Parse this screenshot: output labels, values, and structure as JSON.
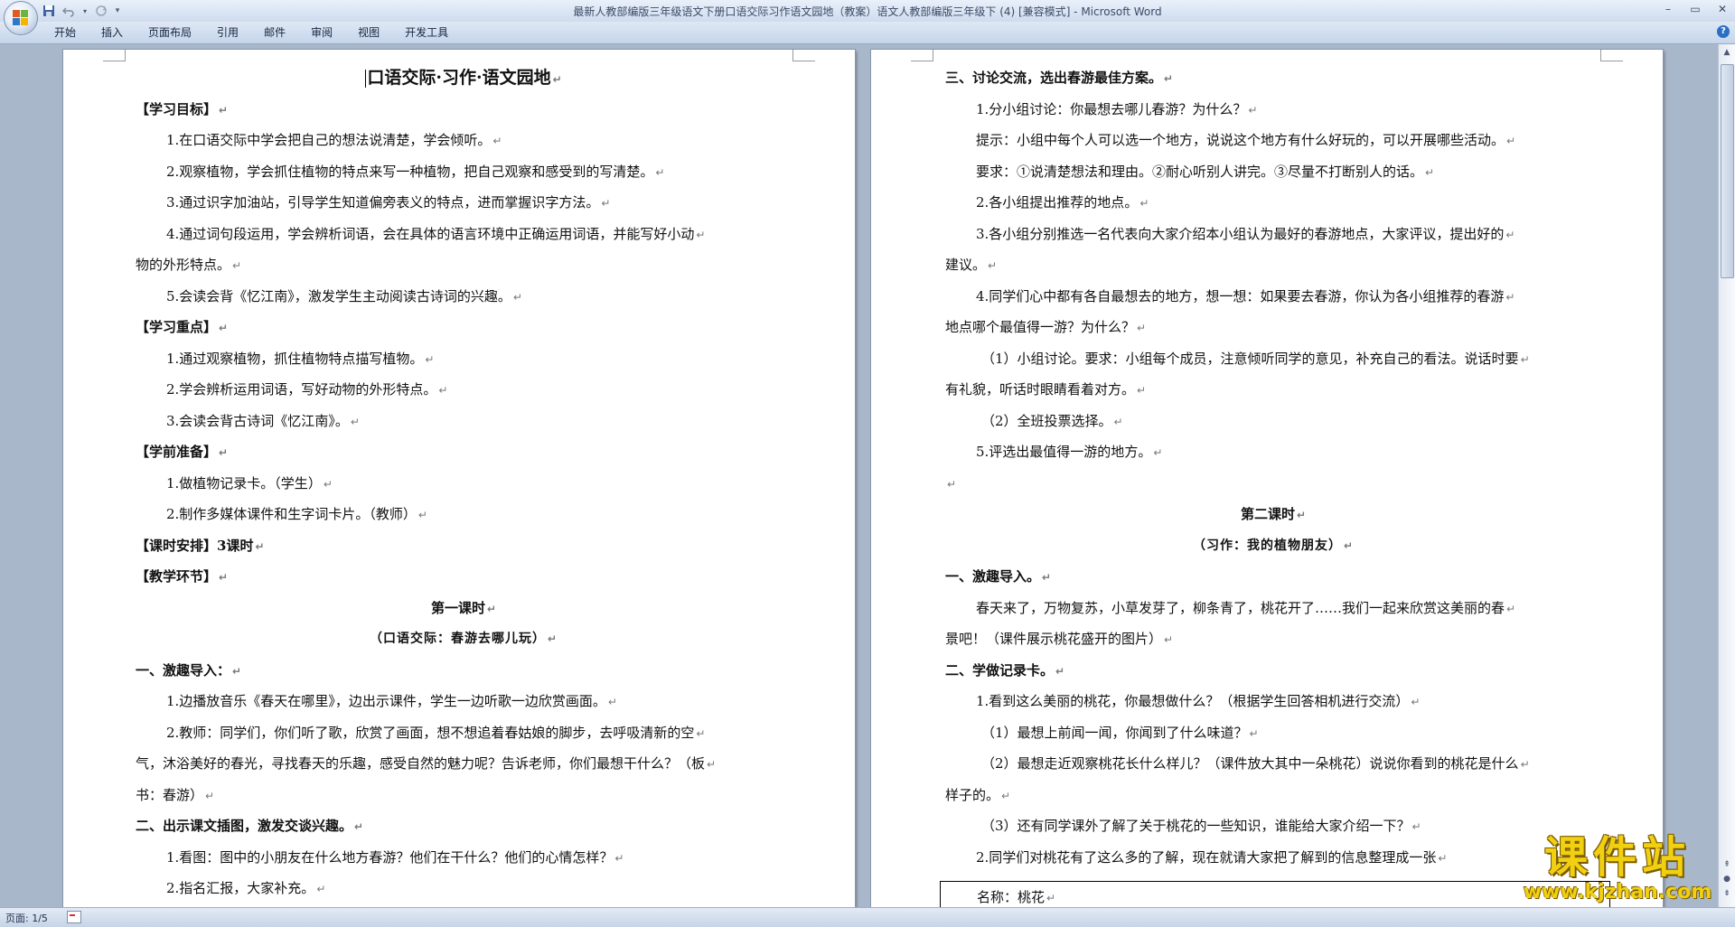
{
  "window": {
    "title": "最新人教部编版三年级语文下册口语交际习作语文园地（教案）语文人教部编版三年级下 (4) [兼容模式] - Microsoft Word",
    "controls": [
      "–",
      "▭",
      "✕"
    ]
  },
  "ribbon": {
    "tabs": [
      "开始",
      "插入",
      "页面布局",
      "引用",
      "邮件",
      "审阅",
      "视图",
      "开发工具"
    ],
    "help": "?"
  },
  "quick_access": [
    "save-icon",
    "undo-icon",
    "redo-icon",
    "customize-icon"
  ],
  "left_page": {
    "title": "口语交际·习作·语文园地",
    "lines": [
      "【学习目标】",
      "1.在口语交际中学会把自己的想法说清楚，学会倾听。",
      "2.观察植物，学会抓住植物的特点来写一种植物，把自己观察和感受到的写清楚。",
      "3.通过识字加油站，引导学生知道偏旁表义的特点，进而掌握识字方法。",
      "4.通过词句段运用，学会辨析词语，会在具体的语言环境中正确运用词语，并能写好小动",
      "物的外形特点。",
      "5.会读会背《忆江南》，激发学生主动阅读古诗词的兴趣。",
      "【学习重点】",
      "1.通过观察植物，抓住植物特点描写植物。",
      "2.学会辨析运用词语，写好动物的外形特点。",
      "3.会读会背古诗词《忆江南》。",
      "【学前准备】",
      "1.做植物记录卡。（学生）",
      "2.制作多媒体课件和生字词卡片。（教师）",
      "【课时安排】3课时",
      "【教学环节】",
      "第一课时",
      "（口语交际：春游去哪儿玩）",
      "一、激趣导入：",
      "1.边播放音乐《春天在哪里》，边出示课件，学生一边听歌一边欣赏画面。",
      "2.教师：同学们，你们听了歌，欣赏了画面，想不想追着春姑娘的脚步，去呼吸清新的空",
      "气，沐浴美好的春光，寻找春天的乐趣，感受自然的魅力呢？告诉老师，你们最想干什么？（板",
      "书：春游）",
      "二、出示课文插图，激发交谈兴趣。",
      "1.看图：图中的小朋友在什么地方春游？他们在干什么？他们的心情怎样？",
      "2.指名汇报，大家补充。"
    ]
  },
  "right_page": {
    "lines": [
      "三、讨论交流，选出春游最佳方案。",
      "1.分小组讨论：你最想去哪儿春游？为什么？",
      "提示：小组中每个人可以选一个地方，说说这个地方有什么好玩的，可以开展哪些活动。",
      "要求：①说清楚想法和理由。②耐心听别人讲完。③尽量不打断别人的话。",
      "2.各小组提出推荐的地点。",
      "3.各小组分别推选一名代表向大家介绍本小组认为最好的春游地点，大家评议，提出好的",
      "建议。",
      "4.同学们心中都有各自最想去的地方，想一想：如果要去春游，你认为各小组推荐的春游",
      "地点哪个最值得一游？为什么？",
      "（1）小组讨论。要求：小组每个成员，注意倾听同学的意见，补充自己的看法。说话时要",
      "有礼貌，听话时眼睛看着对方。",
      "（2）全班投票选择。",
      "5.评选出最值得一游的地方。",
      "",
      "第二课时",
      "（习作：我的植物朋友）",
      "一、激趣导入。",
      "春天来了，万物复苏，小草发芽了，柳条青了，桃花开了……我们一起来欣赏这美丽的春",
      "景吧！（课件展示桃花盛开的图片）",
      "二、学做记录卡。",
      "1.看到这么美丽的桃花，你最想做什么？（根据学生回答相机进行交流）",
      "（1）最想上前闻一闻，你闻到了什么味道？",
      "（2）最想走近观察桃花长什么样儿？（课件放大其中一朵桃花）说说你看到的桃花是什么",
      "样子的。",
      "（3）还有同学课外了解了关于桃花的一些知识，谁能给大家介绍一下？",
      "2.同学们对桃花有了这么多的了解，现在就请大家把了解到的信息整理成一张"
    ],
    "table_cell": "名称：桃花"
  },
  "status_bar": {
    "page": "页面: 1/5"
  },
  "watermark": {
    "title": "课件站",
    "url": "www.kjzhan.com"
  },
  "colors": {
    "accent": "#2b6fc4",
    "watermark": "#f1d012",
    "background": "#a9b7ca"
  }
}
